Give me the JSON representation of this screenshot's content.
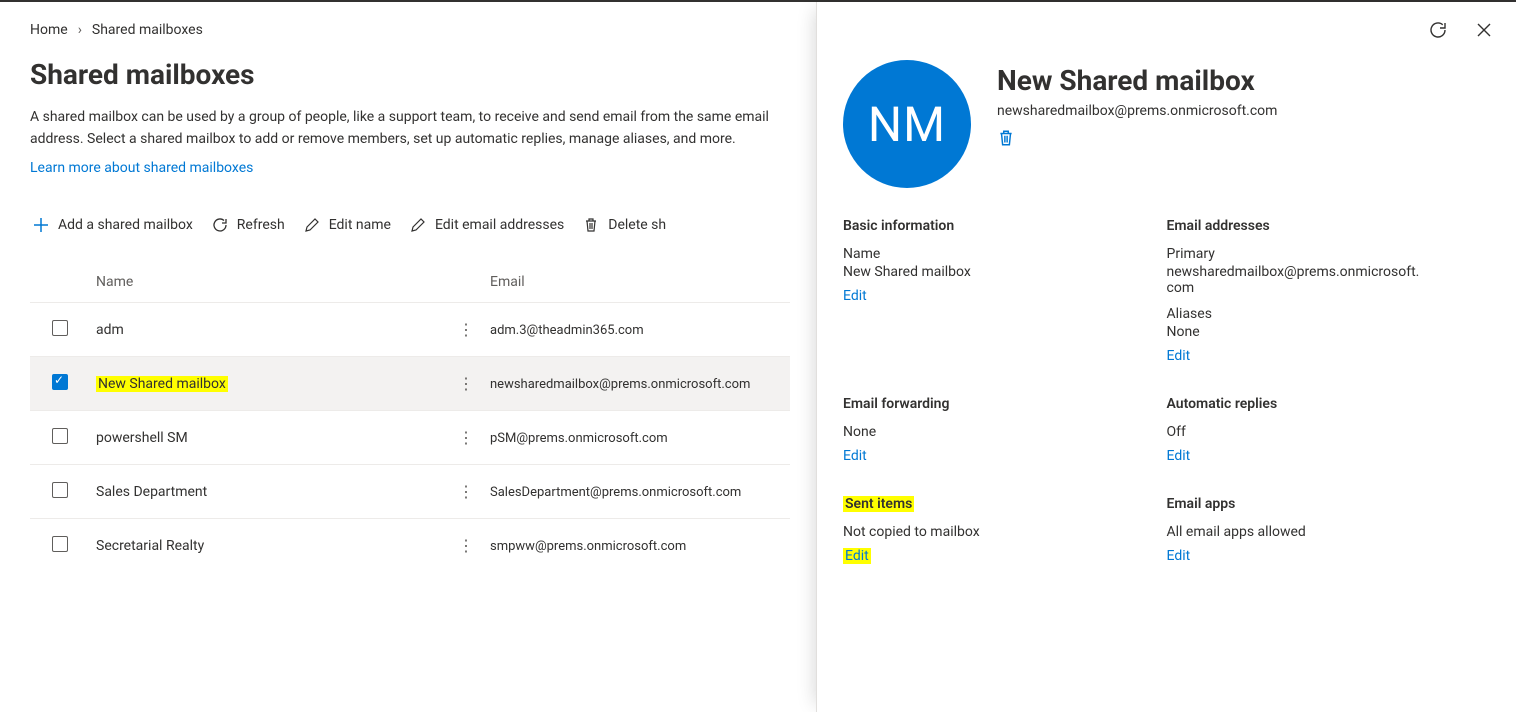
{
  "breadcrumb": {
    "home": "Home",
    "current": "Shared mailboxes"
  },
  "page_title": "Shared mailboxes",
  "description": "A shared mailbox can be used by a group of people, like a support team, to receive and send email from the same email address. Select a shared mailbox to add or remove members, set up automatic replies, manage aliases, and more.",
  "learn_link": "Learn more about shared mailboxes",
  "toolbar": {
    "add": "Add a shared mailbox",
    "refresh": "Refresh",
    "edit_name": "Edit name",
    "edit_email": "Edit email addresses",
    "delete": "Delete sh"
  },
  "table": {
    "headers": {
      "name": "Name",
      "email": "Email"
    },
    "rows": [
      {
        "checked": false,
        "name": "adm",
        "email": "adm.3@theadmin365.com",
        "highlight": false
      },
      {
        "checked": true,
        "name": "New Shared mailbox",
        "email": "newsharedmailbox@prems.onmicrosoft.com",
        "highlight": true
      },
      {
        "checked": false,
        "name": "powershell SM",
        "email": "pSM@prems.onmicrosoft.com",
        "highlight": false
      },
      {
        "checked": false,
        "name": "Sales Department",
        "email": "SalesDepartment@prems.onmicrosoft.com",
        "highlight": false
      },
      {
        "checked": false,
        "name": "Secretarial Realty",
        "email": "smpww@prems.onmicrosoft.com",
        "highlight": false
      }
    ]
  },
  "panel": {
    "avatar_initials": "NM",
    "title": "New Shared mailbox",
    "email": "newsharedmailbox@prems.onmicrosoft.com",
    "sections": {
      "basic": {
        "title": "Basic information",
        "name_label": "Name",
        "name_value": "New Shared mailbox",
        "edit": "Edit"
      },
      "addresses": {
        "title": "Email addresses",
        "primary_label": "Primary",
        "primary_value": "newsharedmailbox@prems.onmicrosoft.com",
        "aliases_label": "Aliases",
        "aliases_value": "None",
        "edit": "Edit"
      },
      "forwarding": {
        "title": "Email forwarding",
        "value": "None",
        "edit": "Edit"
      },
      "autoreply": {
        "title": "Automatic replies",
        "value": "Off",
        "edit": "Edit"
      },
      "sent": {
        "title": "Sent items",
        "value": "Not copied to mailbox",
        "edit": "Edit"
      },
      "apps": {
        "title": "Email apps",
        "value": "All email apps allowed",
        "edit": "Edit"
      }
    }
  }
}
